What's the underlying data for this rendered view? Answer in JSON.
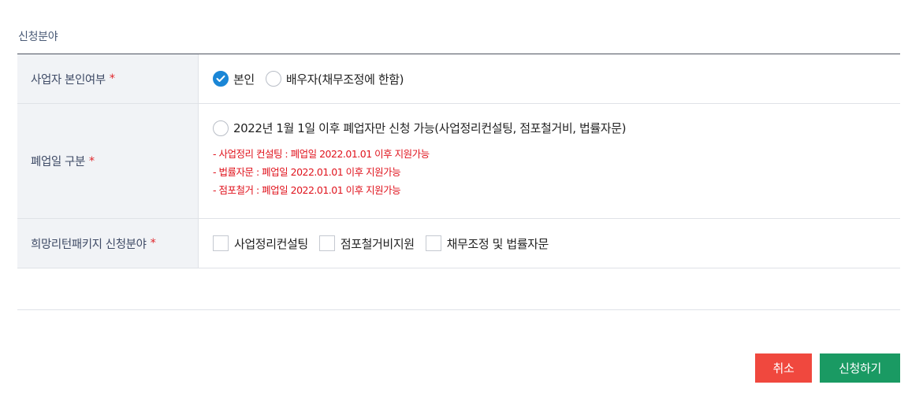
{
  "section_title": "신청분야",
  "required_mark": "*",
  "rows": [
    {
      "label": "사업자 본인여부",
      "options": [
        {
          "label": "본인",
          "checked": true
        },
        {
          "label": "배우자(채무조정에 한함)",
          "checked": false
        }
      ]
    },
    {
      "label": "폐업일 구분",
      "options": [
        {
          "label": "2022년 1월 1일 이후 폐업자만 신청 가능(사업정리컨설팅, 점포철거비, 법률자문)",
          "checked": false
        }
      ],
      "notes": [
        "- 사업정리 컨설팅 : 폐업일 2022.01.01 이후 지원가능",
        "- 법률자문 : 폐업일 2022.01.01 이후 지원가능",
        "- 점포철거 : 폐업일 2022.01.01 이후 지원가능"
      ]
    },
    {
      "label": "희망리턴패키지 신청분야",
      "options": [
        {
          "label": "사업정리컨설팅",
          "checked": false
        },
        {
          "label": "점포철거비지원",
          "checked": false
        },
        {
          "label": "채무조정 및 법률자문",
          "checked": false
        }
      ]
    }
  ],
  "buttons": {
    "cancel": "취소",
    "submit": "신청하기"
  },
  "colors": {
    "accent": "#1a86d6",
    "cancel": "#f0483e",
    "submit": "#1a9a63",
    "required": "#e0262b",
    "note": "#e0141e"
  }
}
